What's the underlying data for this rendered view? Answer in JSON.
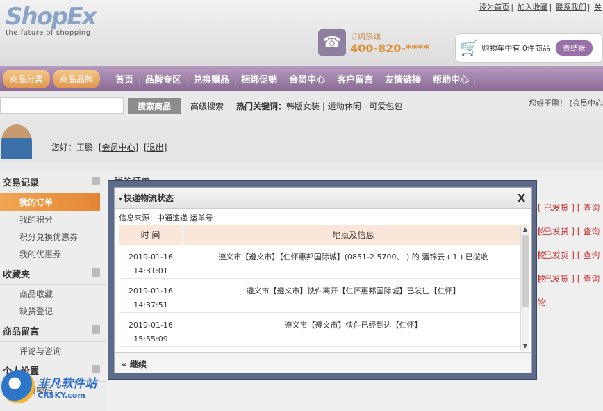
{
  "logo": {
    "name": "ShopEx",
    "tagline": "the future of shopping"
  },
  "top_links": [
    "设为首页",
    "加入收藏",
    "联系我们",
    "关"
  ],
  "hotline": {
    "label": "订购热线",
    "number": "400-820-****"
  },
  "cart": {
    "text": "购物车中有 0件商品",
    "button": "去结账"
  },
  "nav": {
    "categories": "商品分类",
    "brands": "商品品牌",
    "items": [
      "首页",
      "品牌专区",
      "兑换赠品",
      "捆绑促销",
      "会员中心",
      "客户留言",
      "友情链接",
      "帮助中心"
    ]
  },
  "search": {
    "button": "搜索商品",
    "advanced": "高级搜索",
    "hot_label": "热门关键词：",
    "hot": "韩版女装 | 运动休闲 | 可爱包包",
    "greeting": "您好王鹏！ [会员中心"
  },
  "user": {
    "hello": "您好：王鹏",
    "center": "[会员中心]",
    "logout": "[退出]"
  },
  "sidebar": {
    "sections": [
      {
        "title": "交易记录",
        "items": [
          "我的订单",
          "我的积分",
          "积分兑换优惠券",
          "我的优惠券"
        ]
      },
      {
        "title": "收藏夹",
        "items": [
          "商品收藏",
          "缺货登记"
        ]
      },
      {
        "title": "商品留言",
        "items": [
          "评论与咨询"
        ]
      },
      {
        "title": "个人设置",
        "items": [
          "修改密码"
        ]
      }
    ]
  },
  "main_title": "我的订单",
  "right_col": [
    "[ 已发货 ] [ 查询物",
    "[ 已发货 ] [ 查询物",
    "[ 已发货 ] [ 查询物",
    "[ 已发货 ] [ 查询物",
    "[ 已发货 ] [ 查询物"
  ],
  "dialog": {
    "title": "快递物流状态",
    "close": "X",
    "source": "信息来源：中通速递 运单号：",
    "columns": [
      "时 间",
      "地点及信息"
    ],
    "rows": [
      {
        "date": "2019-01-16",
        "time": "14:31:01",
        "info": "遵义市【遵义市】【仁怀惠邦国际城】(0851-2 5700、 ) 的 潘锦云 ( 1 ) 已揽收"
      },
      {
        "date": "2019-01-16",
        "time": "14:37:51",
        "info": "遵义市【遵义市】快件离开【仁怀惠邦国际城】已发往【仁怀】"
      },
      {
        "date": "2019-01-16",
        "time": "15:55:09",
        "info": "遵义市【遵义市】快件已经到达【仁怀】"
      }
    ],
    "footer": "« 继续"
  },
  "watermark": {
    "line1": "非凡软件站",
    "line2": "CRSKY.com"
  }
}
